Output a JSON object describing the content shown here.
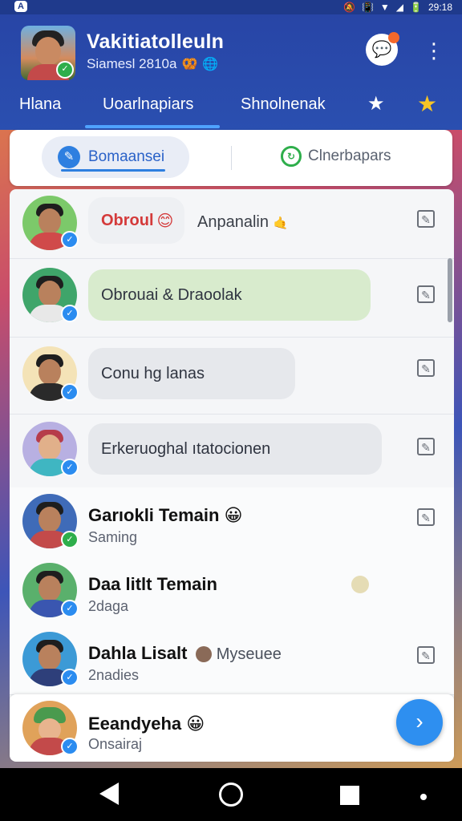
{
  "status_bar": {
    "app_badge": "A",
    "icons": [
      "🔕",
      "📳",
      "▼",
      "◢",
      "🔋"
    ],
    "time": "29:18"
  },
  "header": {
    "title": "Vakitiatolleuln",
    "subtitle": "Siamesl 2810a",
    "subtitle_emojis": [
      "🥨",
      "🌐"
    ],
    "chat_icon": "chat-bubble-icon",
    "more_icon": "⋮"
  },
  "tabs": [
    {
      "label": "Hlana"
    },
    {
      "label": "Uoarlnapiars"
    },
    {
      "label": "Shnolnenak"
    },
    {
      "label": "★"
    },
    {
      "label": "★"
    }
  ],
  "segment": {
    "left_label": "Bomaansei",
    "right_label": "Clnerbapars"
  },
  "rows": [
    {
      "bubble_text": "Obroul",
      "bubble_emoji": "😊",
      "side_text": "Anpanalin",
      "side_emoji": "🤙"
    },
    {
      "bubble_text": "Obrouai & Draoolak"
    },
    {
      "bubble_text": "Conu hg lanas"
    },
    {
      "bubble_text": "Erkeruoghal ıtatocionen"
    },
    {
      "name": "Garıokli Temain",
      "name_emoji": "😀",
      "sub": "Saming"
    },
    {
      "name": "Daa litlt Temain",
      "sub": "2daga"
    },
    {
      "name": "Dahla Lisalt",
      "name_after": "Myseuee",
      "sub": "2nadies"
    },
    {
      "name": "Eeandyeha",
      "name_emoji": "😀",
      "sub": "Onsairaj"
    }
  ],
  "colors": {
    "header": "#2845a6",
    "accent": "#2e8ff0",
    "verified": "#2b8cf0"
  }
}
